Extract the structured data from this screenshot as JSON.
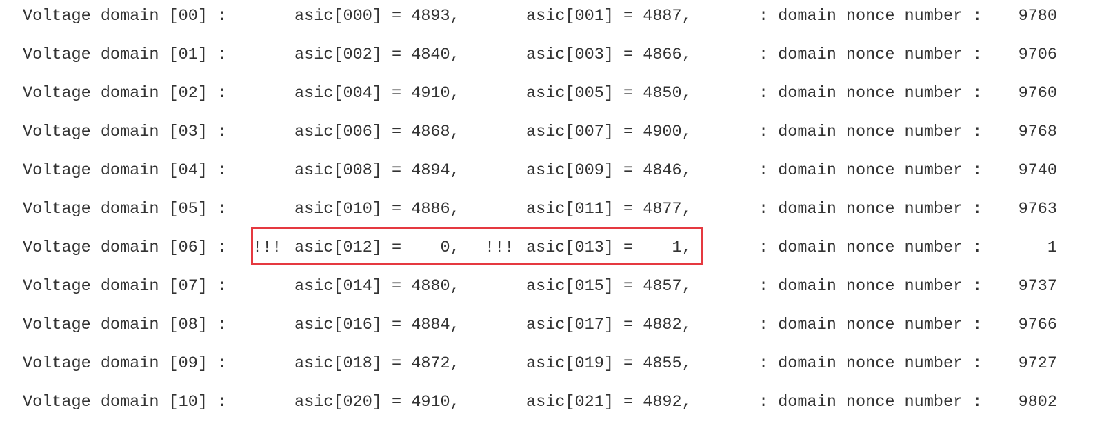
{
  "highlight_color": "#e53940",
  "nonce_label": ": domain nonce number :",
  "flag_marker": "!!!",
  "rows": [
    {
      "domain": "Voltage domain [00] :",
      "asic_a": "asic[000] = 4893,",
      "asic_b": "asic[001] = 4887,",
      "flag_a": "",
      "flag_b": "",
      "nonce": "9780"
    },
    {
      "domain": "Voltage domain [01] :",
      "asic_a": "asic[002] = 4840,",
      "asic_b": "asic[003] = 4866,",
      "flag_a": "",
      "flag_b": "",
      "nonce": "9706"
    },
    {
      "domain": "Voltage domain [02] :",
      "asic_a": "asic[004] = 4910,",
      "asic_b": "asic[005] = 4850,",
      "flag_a": "",
      "flag_b": "",
      "nonce": "9760"
    },
    {
      "domain": "Voltage domain [03] :",
      "asic_a": "asic[006] = 4868,",
      "asic_b": "asic[007] = 4900,",
      "flag_a": "",
      "flag_b": "",
      "nonce": "9768"
    },
    {
      "domain": "Voltage domain [04] :",
      "asic_a": "asic[008] = 4894,",
      "asic_b": "asic[009] = 4846,",
      "flag_a": "",
      "flag_b": "",
      "nonce": "9740"
    },
    {
      "domain": "Voltage domain [05] :",
      "asic_a": "asic[010] = 4886,",
      "asic_b": "asic[011] = 4877,",
      "flag_a": "",
      "flag_b": "",
      "nonce": "9763"
    },
    {
      "domain": "Voltage domain [06] :",
      "asic_a": "asic[012] =    0,",
      "asic_b": "asic[013] =    1,",
      "flag_a": "!!!",
      "flag_b": "!!!",
      "nonce": "1",
      "highlighted": true
    },
    {
      "domain": "Voltage domain [07] :",
      "asic_a": "asic[014] = 4880,",
      "asic_b": "asic[015] = 4857,",
      "flag_a": "",
      "flag_b": "",
      "nonce": "9737"
    },
    {
      "domain": "Voltage domain [08] :",
      "asic_a": "asic[016] = 4884,",
      "asic_b": "asic[017] = 4882,",
      "flag_a": "",
      "flag_b": "",
      "nonce": "9766"
    },
    {
      "domain": "Voltage domain [09] :",
      "asic_a": "asic[018] = 4872,",
      "asic_b": "asic[019] = 4855,",
      "flag_a": "",
      "flag_b": "",
      "nonce": "9727"
    },
    {
      "domain": "Voltage domain [10] :",
      "asic_a": "asic[020] = 4910,",
      "asic_b": "asic[021] = 4892,",
      "flag_a": "",
      "flag_b": "",
      "nonce": "9802"
    }
  ]
}
